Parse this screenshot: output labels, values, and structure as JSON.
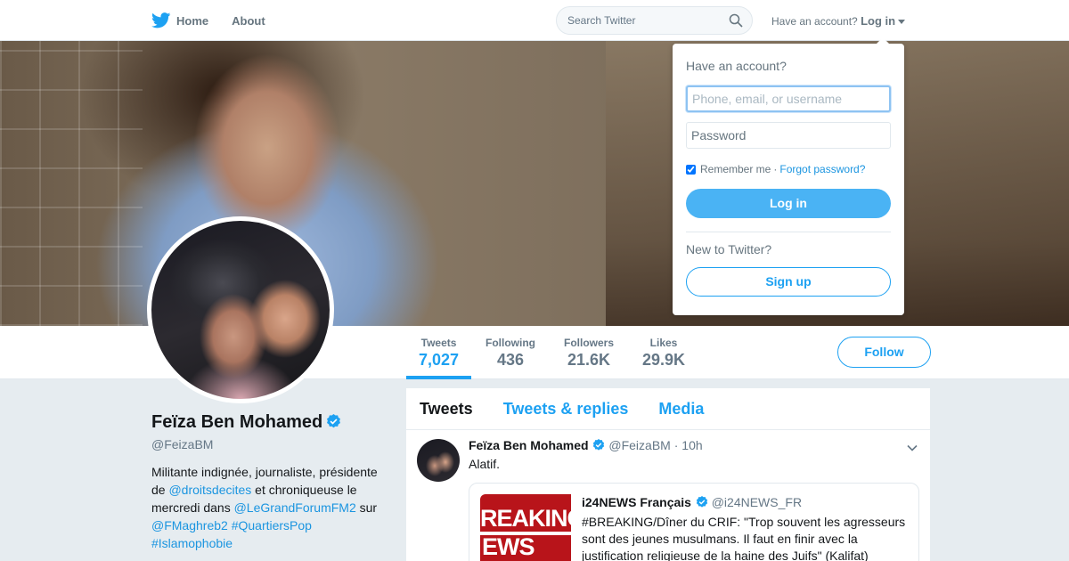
{
  "nav": {
    "home_label": "Home",
    "about_label": "About",
    "search_placeholder": "Search Twitter",
    "account_prompt": "Have an account?",
    "login_label": "Log in"
  },
  "profile": {
    "name": "Feïza Ben Mohamed",
    "handle": "@FeizaBM",
    "bio": {
      "t1": "Militante indignée, journaliste, présidente de ",
      "l1": "@droitsdecites",
      "t2": " et chroniqueuse le mercredi dans ",
      "l2": "@LeGrandForumFM2",
      "t3": " sur ",
      "l3": "@FMaghreb2",
      "t4": " ",
      "l4": "#QuartiersPop",
      "t5": " ",
      "l5": "#Islamophobie"
    },
    "stats": [
      {
        "label": "Tweets",
        "value": "7,027"
      },
      {
        "label": "Following",
        "value": "436"
      },
      {
        "label": "Followers",
        "value": "21.6K"
      },
      {
        "label": "Likes",
        "value": "29.9K"
      }
    ],
    "follow_label": "Follow"
  },
  "timeline": {
    "tabs": [
      "Tweets",
      "Tweets & replies",
      "Media"
    ],
    "tweet": {
      "author": "Feïza Ben Mohamed",
      "handle": "@FeizaBM",
      "time": "10h",
      "separator": "·",
      "text": "Alatif.",
      "quote": {
        "author": "i24NEWS Français",
        "handle": "@i24NEWS_FR",
        "text": "#BREAKING/Dîner du CRIF: \"Trop souvent les agresseurs sont des jeunes musulmans. Il faut en finir avec la justification religieuse de la haine des Juifs\" (Kalifat)",
        "image_text_1": "REAKING",
        "image_text_2": "EWS"
      }
    }
  },
  "login_dropdown": {
    "title": "Have an account?",
    "username_placeholder": "Phone, email, or username",
    "password_placeholder": "Password",
    "remember_label": "Remember me",
    "separator": "·",
    "forgot_label": "Forgot password?",
    "login_button": "Log in",
    "new_prompt": "New to Twitter?",
    "signup_button": "Sign up"
  },
  "colors": {
    "accent": "#1da1f2",
    "login_button": "#4ab3f4",
    "link": "#1b95e0",
    "page_bg": "#e6ecf0"
  },
  "icons": [
    "twitter-bird-icon",
    "search-icon",
    "caret-down-icon",
    "verified-badge-icon",
    "chevron-down-icon"
  ]
}
